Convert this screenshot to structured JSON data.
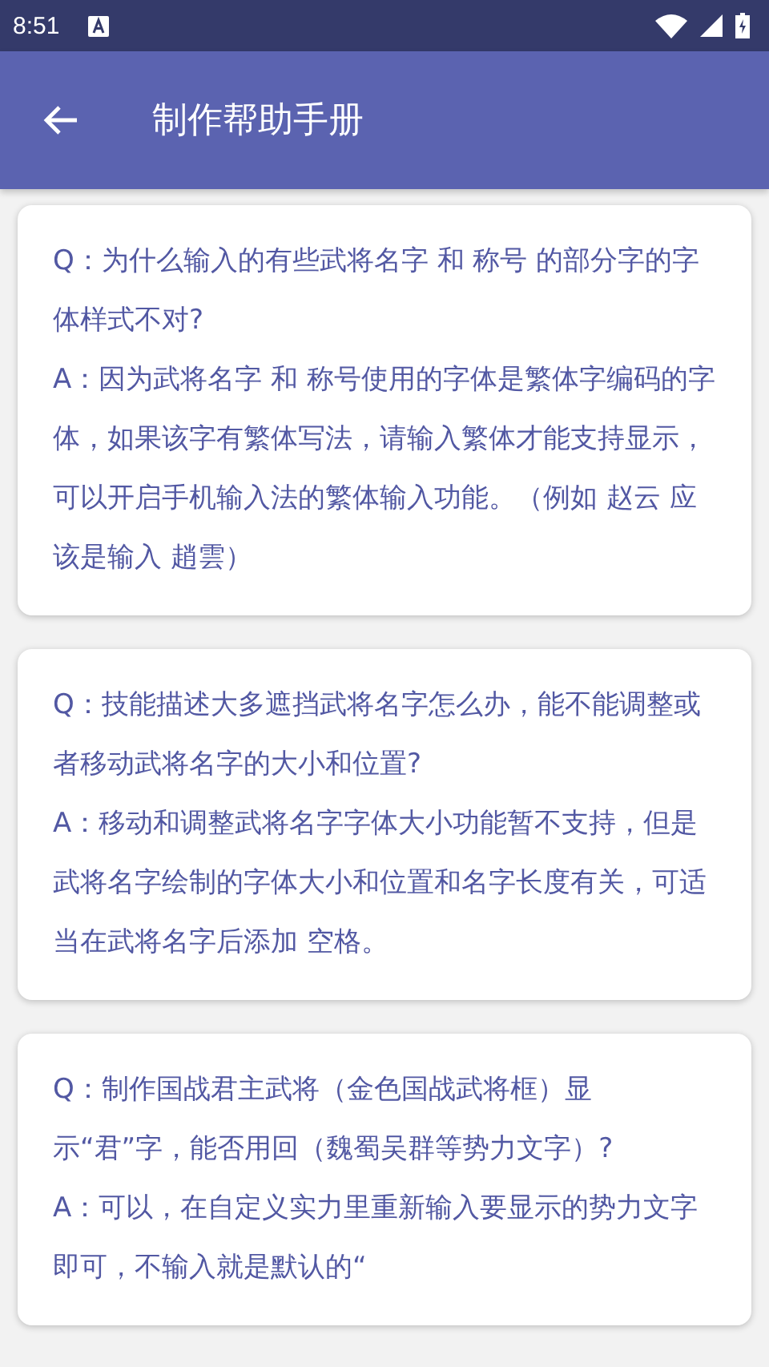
{
  "status_bar": {
    "time": "8:51"
  },
  "app_bar": {
    "title": "制作帮助手册"
  },
  "faq": [
    {
      "question": "Q：为什么输入的有些武将名字 和 称号 的部分字的字体样式不对?",
      "answer": "A：因为武将名字 和 称号使用的字体是繁体字编码的字体，如果该字有繁体写法，请输入繁体才能支持显示，可以开启手机输入法的繁体输入功能。（例如 赵云 应该是输入 趙雲）"
    },
    {
      "question": "Q：技能描述大多遮挡武将名字怎么办，能不能调整或者移动武将名字的大小和位置?",
      "answer": "A：移动和调整武将名字字体大小功能暂不支持，但是武将名字绘制的字体大小和位置和名字长度有关，可适当在武将名字后添加 空格。"
    },
    {
      "question": "Q：制作国战君主武将（金色国战武将框）显示“君”字，能否用回（魏蜀吴群等势力文字）?",
      "answer": "A：可以，在自定义实力里重新输入要显示的势力文字即可，不输入就是默认的“"
    }
  ]
}
